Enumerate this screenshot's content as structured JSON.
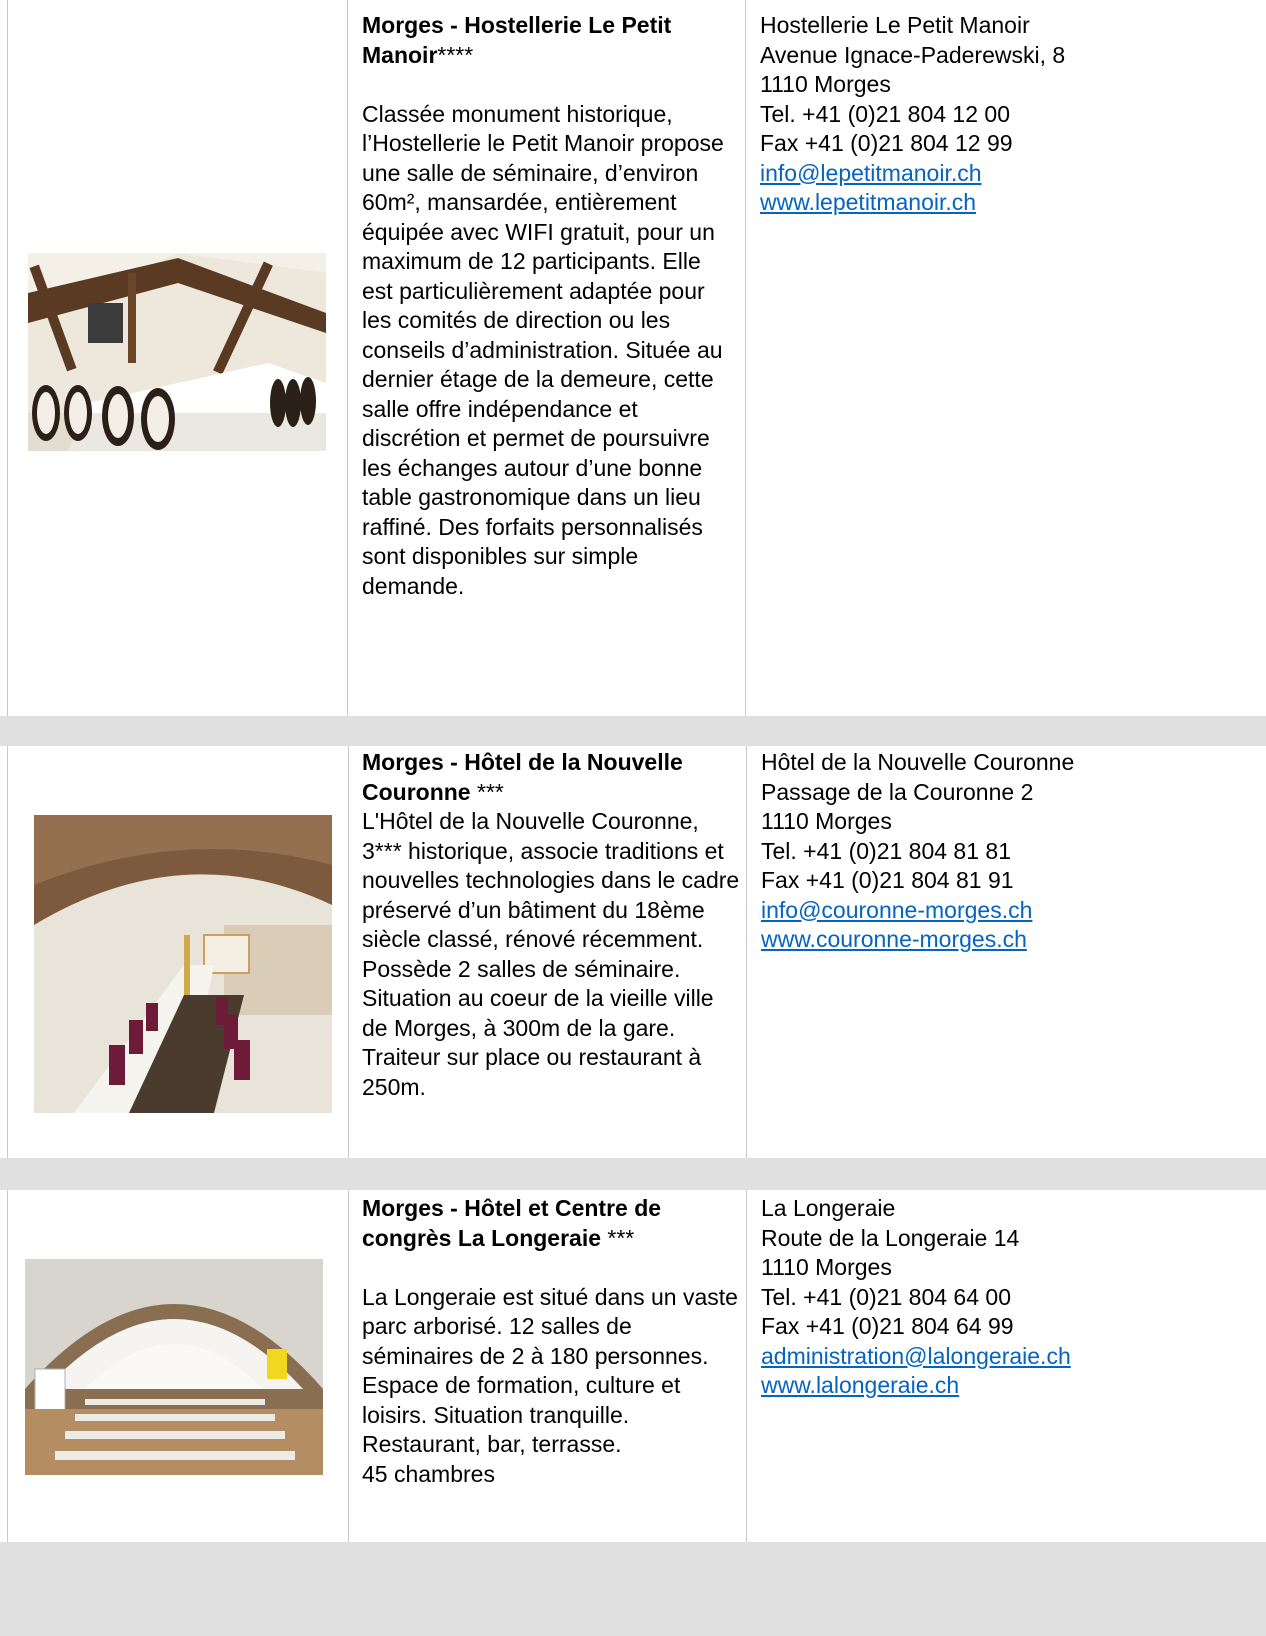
{
  "entries": [
    {
      "title": "Morges - Hostellerie Le Petit Manoir",
      "stars": "****",
      "description": "Classée monument historique, l’Hostellerie le Petit Manoir propose une salle de séminaire, d’environ 60m², mansardée, entièrement équipée avec WIFI gratuit, pour un maximum de 12 participants. Elle est particulièrement adaptée pour les comités de direction ou les conseils d’administration. Située au dernier étage de la demeure, cette salle offre indépendance et discrétion et permet de poursuivre les échanges autour d’une bonne table gastronomique dans un lieu raffiné. Des forfaits personnalisés sont disponibles sur simple demande.",
      "contact": {
        "name": "Hostellerie Le Petit Manoir",
        "street": "Avenue Ignace-Paderewski, 8",
        "city": "1110 Morges",
        "tel": "Tel. +41 (0)21 804 12 00",
        "fax": "Fax +41 (0)21 804 12 99",
        "email": "info@lepetitmanoir.ch",
        "web": "www.lepetitmanoir.ch"
      }
    },
    {
      "title": "Morges - Hôtel de la Nouvelle Couronne",
      "stars": " ***",
      "description": "L'Hôtel de la Nouvelle Couronne, 3*** historique, associe traditions et nouvelles technologies dans le cadre préservé d’un bâtiment du 18ème siècle classé, rénové récemment. Possède 2 salles de séminaire. Situation au coeur de la vieille ville de Morges, à 300m de la gare. Traiteur sur place ou restaurant à 250m.",
      "contact": {
        "name": "Hôtel de la Nouvelle Couronne",
        "street": "Passage de la Couronne 2",
        "city": "1110 Morges",
        "tel": "Tel. +41 (0)21 804 81 81",
        "fax": "Fax +41 (0)21 804 81 91",
        "email": "info@couronne-morges.ch",
        "web": "www.couronne-morges.ch"
      }
    },
    {
      "title": "Morges - Hôtel et Centre de congrès La Longeraie",
      "stars": " ***",
      "description": "La Longeraie est situé dans un vaste parc arborisé. 12 salles de séminaires de 2 à 180 personnes. Espace de formation, culture et loisirs. Situation tranquille. Restaurant, bar, terrasse.",
      "extra": "45 chambres",
      "contact": {
        "name": "La Longeraie",
        "street": "Route de la Longeraie 14",
        "city": "1110 Morges",
        "tel": "Tel. +41 (0)21 804 64 00",
        "fax": "Fax +41 (0)21 804 64 99",
        "email": "administration@lalongeraie.ch",
        "web": "www.lalongeraie.ch"
      }
    }
  ],
  "colors": {
    "link": "#0563c1",
    "separator": "#e0e0e0",
    "border": "#c9c9c9"
  }
}
